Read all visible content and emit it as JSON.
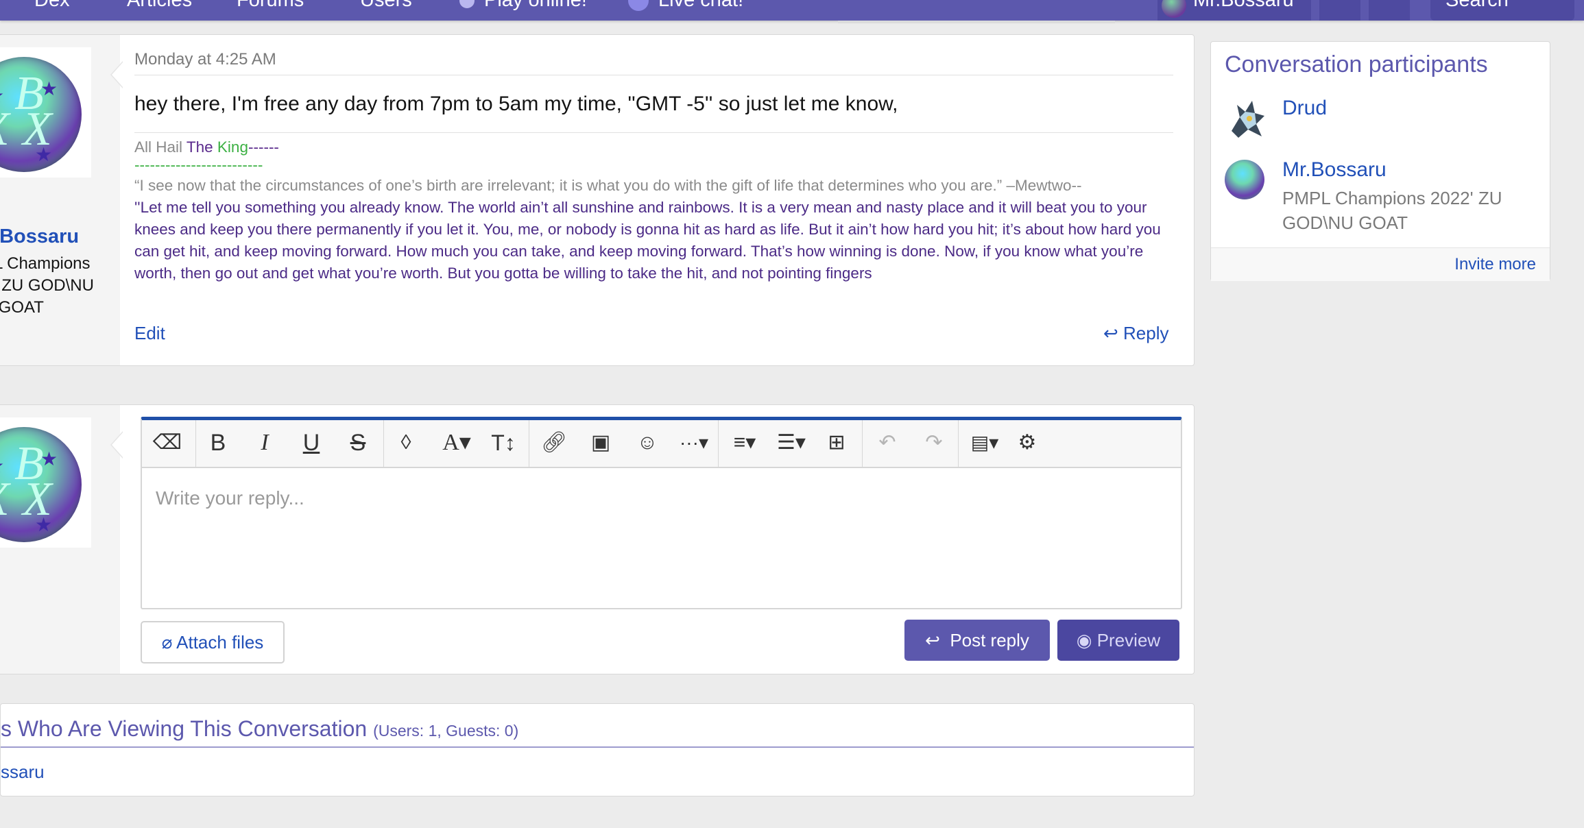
{
  "nav": {
    "items": [
      "Dex",
      "Articles",
      "Forums",
      "Users",
      "Play online!",
      "Live chat!"
    ],
    "user": "Mr.Bossaru",
    "search": "Search"
  },
  "message": {
    "author": "Mr.Bossaru",
    "author_title": "PMPL Champions 2022' ZU GOD\\NU GOAT",
    "date": "Monday at 4:25 AM",
    "body": "hey there, I'm free any day from 7pm to 5am my time, ''GMT -5'' so just let me know,",
    "signature": {
      "line1_prefix": "All Hail ",
      "line1_the": "The",
      "line1_king": "King",
      "line1_dashes": "------",
      "line2": "-------------------------",
      "quote1": "“I see now that the circumstances of one’s birth are irrelevant; it is what you do with the gift of life that determines who you are.” –Mewtwo--",
      "quote2": "''Let me tell you something you already know. The world ain’t all sunshine and rainbows. It is a very mean and nasty place and it will beat you to your knees and keep you there permanently if you let it. You, me, or nobody is gonna hit as hard as life. But it ain’t how hard you hit; it’s about how hard you can get hit, and keep moving forward. How much you can take, and keep moving forward. That’s how winning is done. Now, if you know what you’re worth, then go out and get what you’re worth. But you gotta be willing to take the hit, and not pointing fingers"
    },
    "edit": "Edit",
    "reply": "Reply"
  },
  "editor": {
    "placeholder": "Write your reply...",
    "attach": "Attach files",
    "post_reply": "Post reply",
    "preview": "Preview"
  },
  "sidebar": {
    "title": "Conversation participants",
    "participants": [
      {
        "name": "Drud",
        "title": ""
      },
      {
        "name": "Mr.Bossaru",
        "title": "PMPL Champions 2022' ZU GOD\\NU GOAT"
      }
    ],
    "invite": "Invite more"
  },
  "viewers": {
    "title": "s Who Are Viewing This Conversation",
    "counts": "(Users: 1, Guests: 0)",
    "user": "ssaru"
  },
  "colors": {
    "nav": "#5c58ad",
    "link": "#2150b8",
    "accent": "#1f4fa8"
  }
}
